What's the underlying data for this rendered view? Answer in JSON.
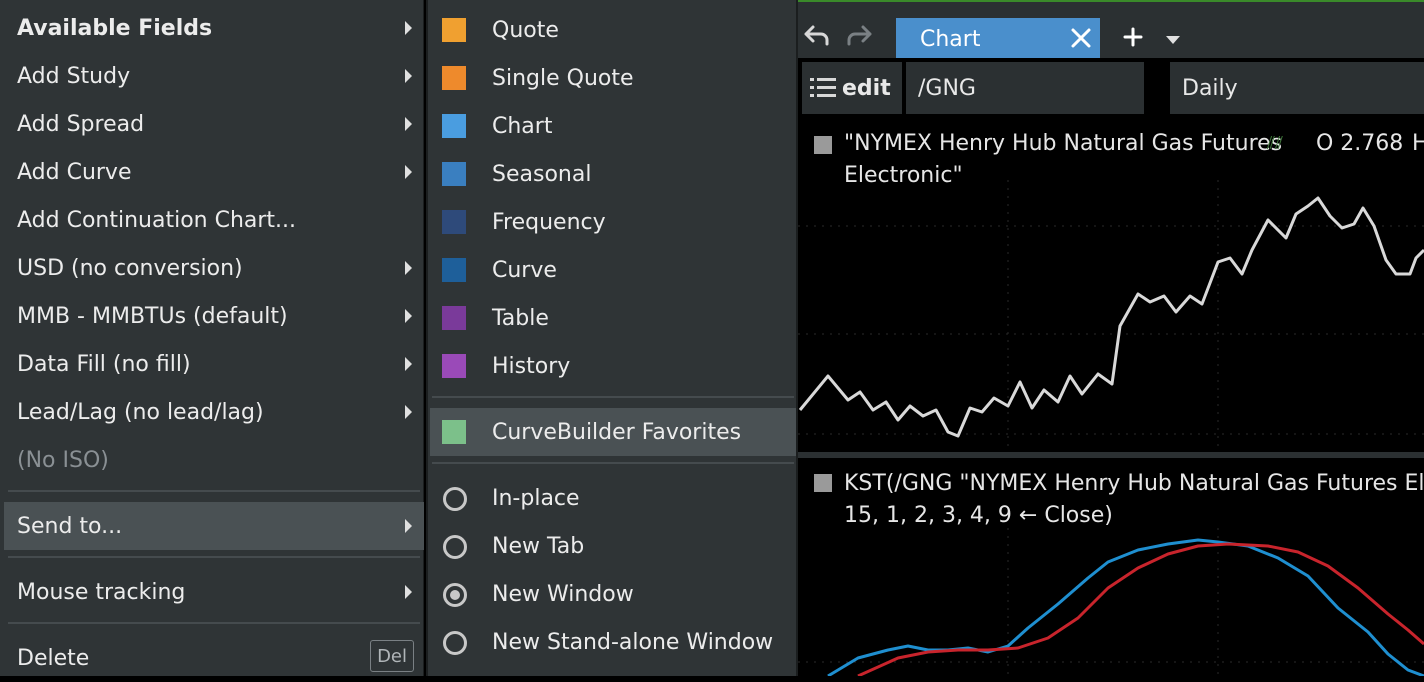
{
  "main_menu": {
    "items": [
      {
        "label": "Available Fields",
        "submenu": true,
        "bold": true
      },
      {
        "label": "Add Study",
        "submenu": true
      },
      {
        "label": "Add Spread",
        "submenu": true
      },
      {
        "label": "Add Curve",
        "submenu": true
      },
      {
        "label": "Add Continuation Chart...",
        "submenu": false
      },
      {
        "label": "USD (no conversion)",
        "submenu": true
      },
      {
        "label": "MMB - MMBTUs (default)",
        "submenu": true
      },
      {
        "label": "Data Fill (no fill)",
        "submenu": true
      },
      {
        "label": "Lead/Lag (no lead/lag)",
        "submenu": true
      },
      {
        "label": "(No ISO)",
        "submenu": false,
        "disabled": true
      }
    ],
    "send_to": "Send to...",
    "mouse_tracking": "Mouse tracking",
    "delete": "Delete",
    "delete_shortcut": "Del"
  },
  "sub_menu": {
    "views": [
      {
        "label": "Quote",
        "color": "#f0a030"
      },
      {
        "label": "Single Quote",
        "color": "#ee8a2c"
      },
      {
        "label": "Chart",
        "color": "#4a9de0"
      },
      {
        "label": "Seasonal",
        "color": "#3a7fc0"
      },
      {
        "label": "Frequency",
        "color": "#2e4a7a"
      },
      {
        "label": "Curve",
        "color": "#1e5f9a"
      },
      {
        "label": "Table",
        "color": "#7a3a9a"
      },
      {
        "label": "History",
        "color": "#9a4ab8"
      }
    ],
    "favorites": {
      "label": "CurveBuilder Favorites",
      "color": "#7cc08a"
    },
    "targets": [
      {
        "label": "In-place",
        "selected": false
      },
      {
        "label": "New Tab",
        "selected": false
      },
      {
        "label": "New Window",
        "selected": true
      },
      {
        "label": "New Stand-alone Window",
        "selected": false
      }
    ]
  },
  "chart_app": {
    "tab_label": "Chart",
    "edit_label": "edit",
    "symbol": "/GNG",
    "period": "Daily",
    "pane1": {
      "legend_line1": "\"NYMEX Henry Hub Natural Gas Futures",
      "open_label": "O 2.768",
      "cut_label": "H",
      "legend_line2": "Electronic\""
    },
    "pane2": {
      "legend_line1": "KST(/GNG \"NYMEX Henry Hub Natural Gas Futures Elec",
      "legend_line2": "15, 1, 2, 3, 4, 9 ← Close)"
    },
    "colors": {
      "accent": "#4a8fcc",
      "price_line": "#d9d9d9",
      "kst": "#1f8fd0",
      "signal": "#c8242c"
    }
  }
}
